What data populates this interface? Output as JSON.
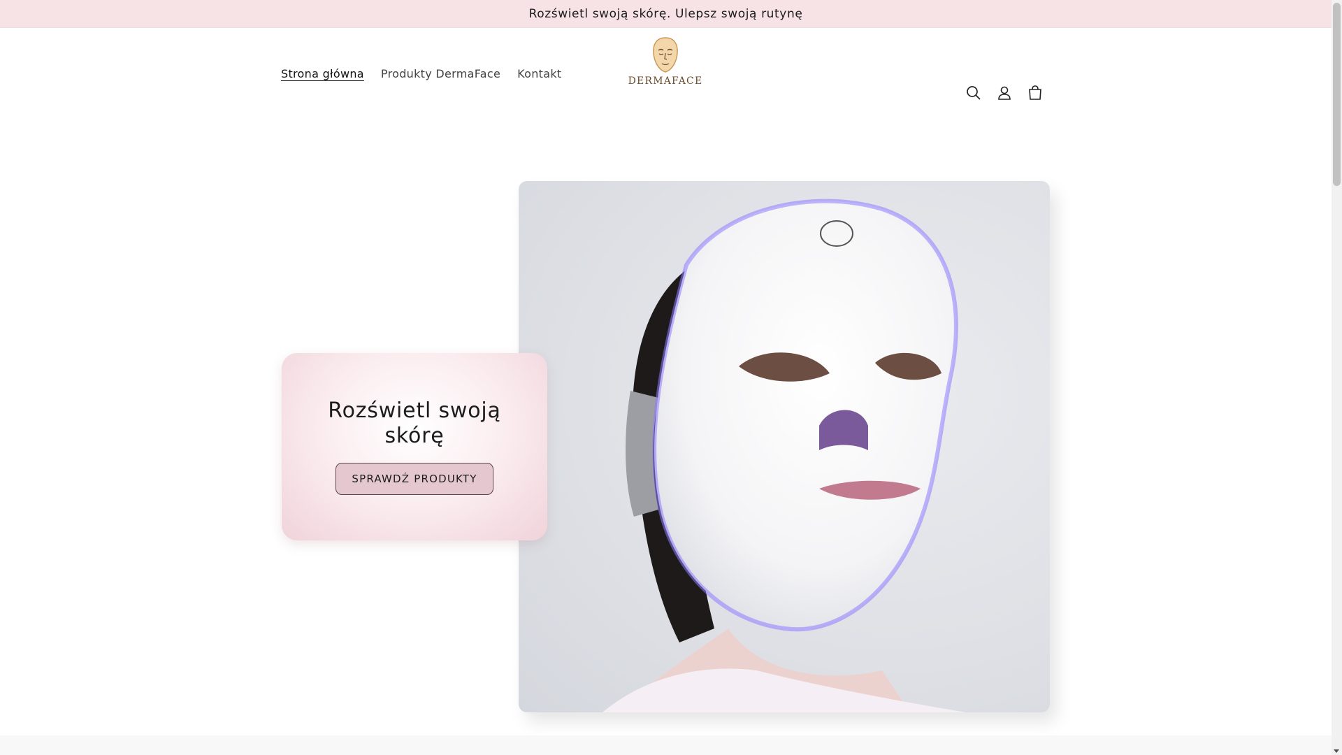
{
  "announcement": {
    "text": "Rozświetl swoją skórę. Ulepsz swoją rutynę"
  },
  "header": {
    "nav": [
      {
        "label": "Strona główna",
        "active": true
      },
      {
        "label": "Produkty DermaFace",
        "active": false
      },
      {
        "label": "Kontakt",
        "active": false
      }
    ],
    "logo_text": "DERMAFACE",
    "icons": [
      "search-icon",
      "account-icon",
      "cart-icon"
    ]
  },
  "hero": {
    "heading": "Rozświetl swoją skórę",
    "cta_label": "SPRAWDŹ PRODUKTY"
  },
  "colors": {
    "announcement_bg": "#f7e3e6",
    "cta_bg": "#e5c8cf",
    "logo_brown": "#6b4a2b",
    "logo_gold": "#d7a85d"
  }
}
